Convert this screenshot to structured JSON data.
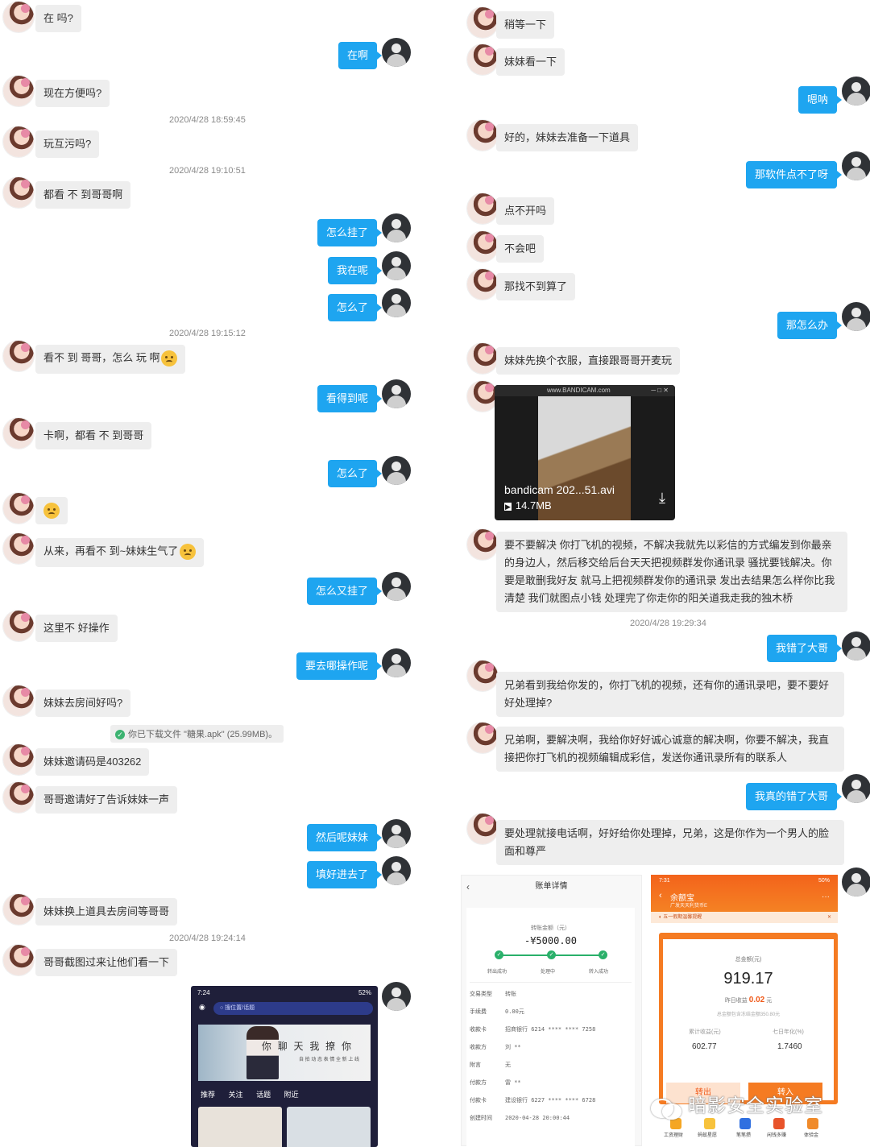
{
  "left_chat": {
    "m1": "在 吗?",
    "r1": "在啊",
    "m2": "现在方便吗?",
    "ts1": "2020/4/28 18:59:45",
    "m3": "玩互污吗?",
    "ts2": "2020/4/28 19:10:51",
    "m4": "都看 不 到哥哥啊",
    "r2": "怎么挂了",
    "r3": "我在呢",
    "r4": "怎么了",
    "ts3": "2020/4/28 19:15:12",
    "m5": "看不 到 哥哥，怎么 玩 啊",
    "r5": "看得到呢",
    "m6": "卡啊，都看 不 到哥哥",
    "r6": "怎么了",
    "m8": "从来，再看不 到~妹妹生气了",
    "r7": "怎么又挂了",
    "m9": "这里不 好操作",
    "r8": "要去哪操作呢",
    "m10": "妹妹去房间好吗?",
    "sys1": "你已下载文件 \"糖果.apk\" (25.99MB)。",
    "m11": "妹妹邀请码是403262",
    "m12": "哥哥邀请好了告诉妹妹一声",
    "r9": "然后呢妹妹",
    "r10": "填好进去了",
    "m13": "妹妹换上道具去房间等哥哥",
    "ts4": "2020/4/28 19:24:14",
    "m14": "哥哥截图过来让他们看一下"
  },
  "phone_shot": {
    "time": "7:24",
    "status": "52%",
    "search_placeholder": "搜位置/话题",
    "banner_title": "你 聊 天 我 撩 你",
    "banner_sub": "自 拍 动 态 表 情 全 新 上 线",
    "tabs": [
      "推荐",
      "关注",
      "话题",
      "附近"
    ]
  },
  "right_chat": {
    "m1": "稍等一下",
    "m2": "妹妹看一下",
    "r1": "嗯呐",
    "m3": "好的，妹妹去准备一下道具",
    "r2": "那软件点不了呀",
    "m4": "点不开吗",
    "m5": "不会吧",
    "m6": "那找不到算了",
    "r3": "那怎么办",
    "m7": "妹妹先换个衣服，直接跟哥哥开麦玩",
    "video_name": "bandicam 202...51.avi",
    "video_size": "14.7MB",
    "video_brand": "www.BANDICAM.com",
    "m8": "要不要解决 你打飞机的视频，不解决我就先以彩信的方式编发到你最亲的身边人，然后移交给后台天天把视频群发你通讯录 骚扰要钱解决。你要是敢删我好友 就马上把视频群发你的通讯录 发出去结果怎么样你比我清楚 我们就图点小钱 处理完了你走你的阳关道我走我的独木桥",
    "ts1": "2020/4/28 19:29:34",
    "r4": "我错了大哥",
    "m9": "兄弟看到我给你发的，你打飞机的视频，还有你的通讯录吧，要不要好好处理掉?",
    "m10": "兄弟啊，要解决啊，我给你好好诚心诚意的解决啊，你要不解决，我直接把你打飞机的视频编辑成彩信，发送你通讯录所有的联系人",
    "r5": "我真的错了大哥",
    "m11": "要处理就接电话啊，好好给你处理掉，兄弟，这是你作为一个男人的脸面和尊严"
  },
  "bill": {
    "header": "账单详情",
    "amount_label": "转账金额（元）",
    "amount": "-¥5000.00",
    "steps": [
      "转出成功",
      "处理中",
      "转入成功"
    ],
    "rows": [
      {
        "k": "交易类型",
        "v": "转账"
      },
      {
        "k": "手续费",
        "v": "0.00元"
      },
      {
        "k": "收款卡",
        "v": "招商银行 6214 **** **** 7258"
      },
      {
        "k": "收款方",
        "v": "刘 **"
      },
      {
        "k": "附言",
        "v": "无"
      },
      {
        "k": "付款方",
        "v": "雷 **"
      },
      {
        "k": "付款卡",
        "v": "建设银行 6227 **** **** 6728"
      },
      {
        "k": "创建时间",
        "v": "2020-04-28 20:00:44"
      }
    ]
  },
  "yuebao": {
    "time": "7:31",
    "battery": "50%",
    "title": "余额宝",
    "subtitle": "广发天天利货币E",
    "notice": "五一假期温馨提醒",
    "total_label": "总金额(元)",
    "total": "919.17",
    "yesterday_label": "昨日收益",
    "yesterday": "0.02",
    "yesterday_unit": "元",
    "note": "总金额包含冻结金额350.80元",
    "cum_label": "累计收益(元)",
    "cum": "602.77",
    "rate_label": "七日年化(%)",
    "rate": "1.7460",
    "out_btn": "转出",
    "in_btn": "转入",
    "nav": [
      "工资理财",
      "蚂蚁星愿",
      "笔笔攒",
      "闲钱多赚",
      "体验金"
    ]
  },
  "watermark": "暗影安全实验室"
}
